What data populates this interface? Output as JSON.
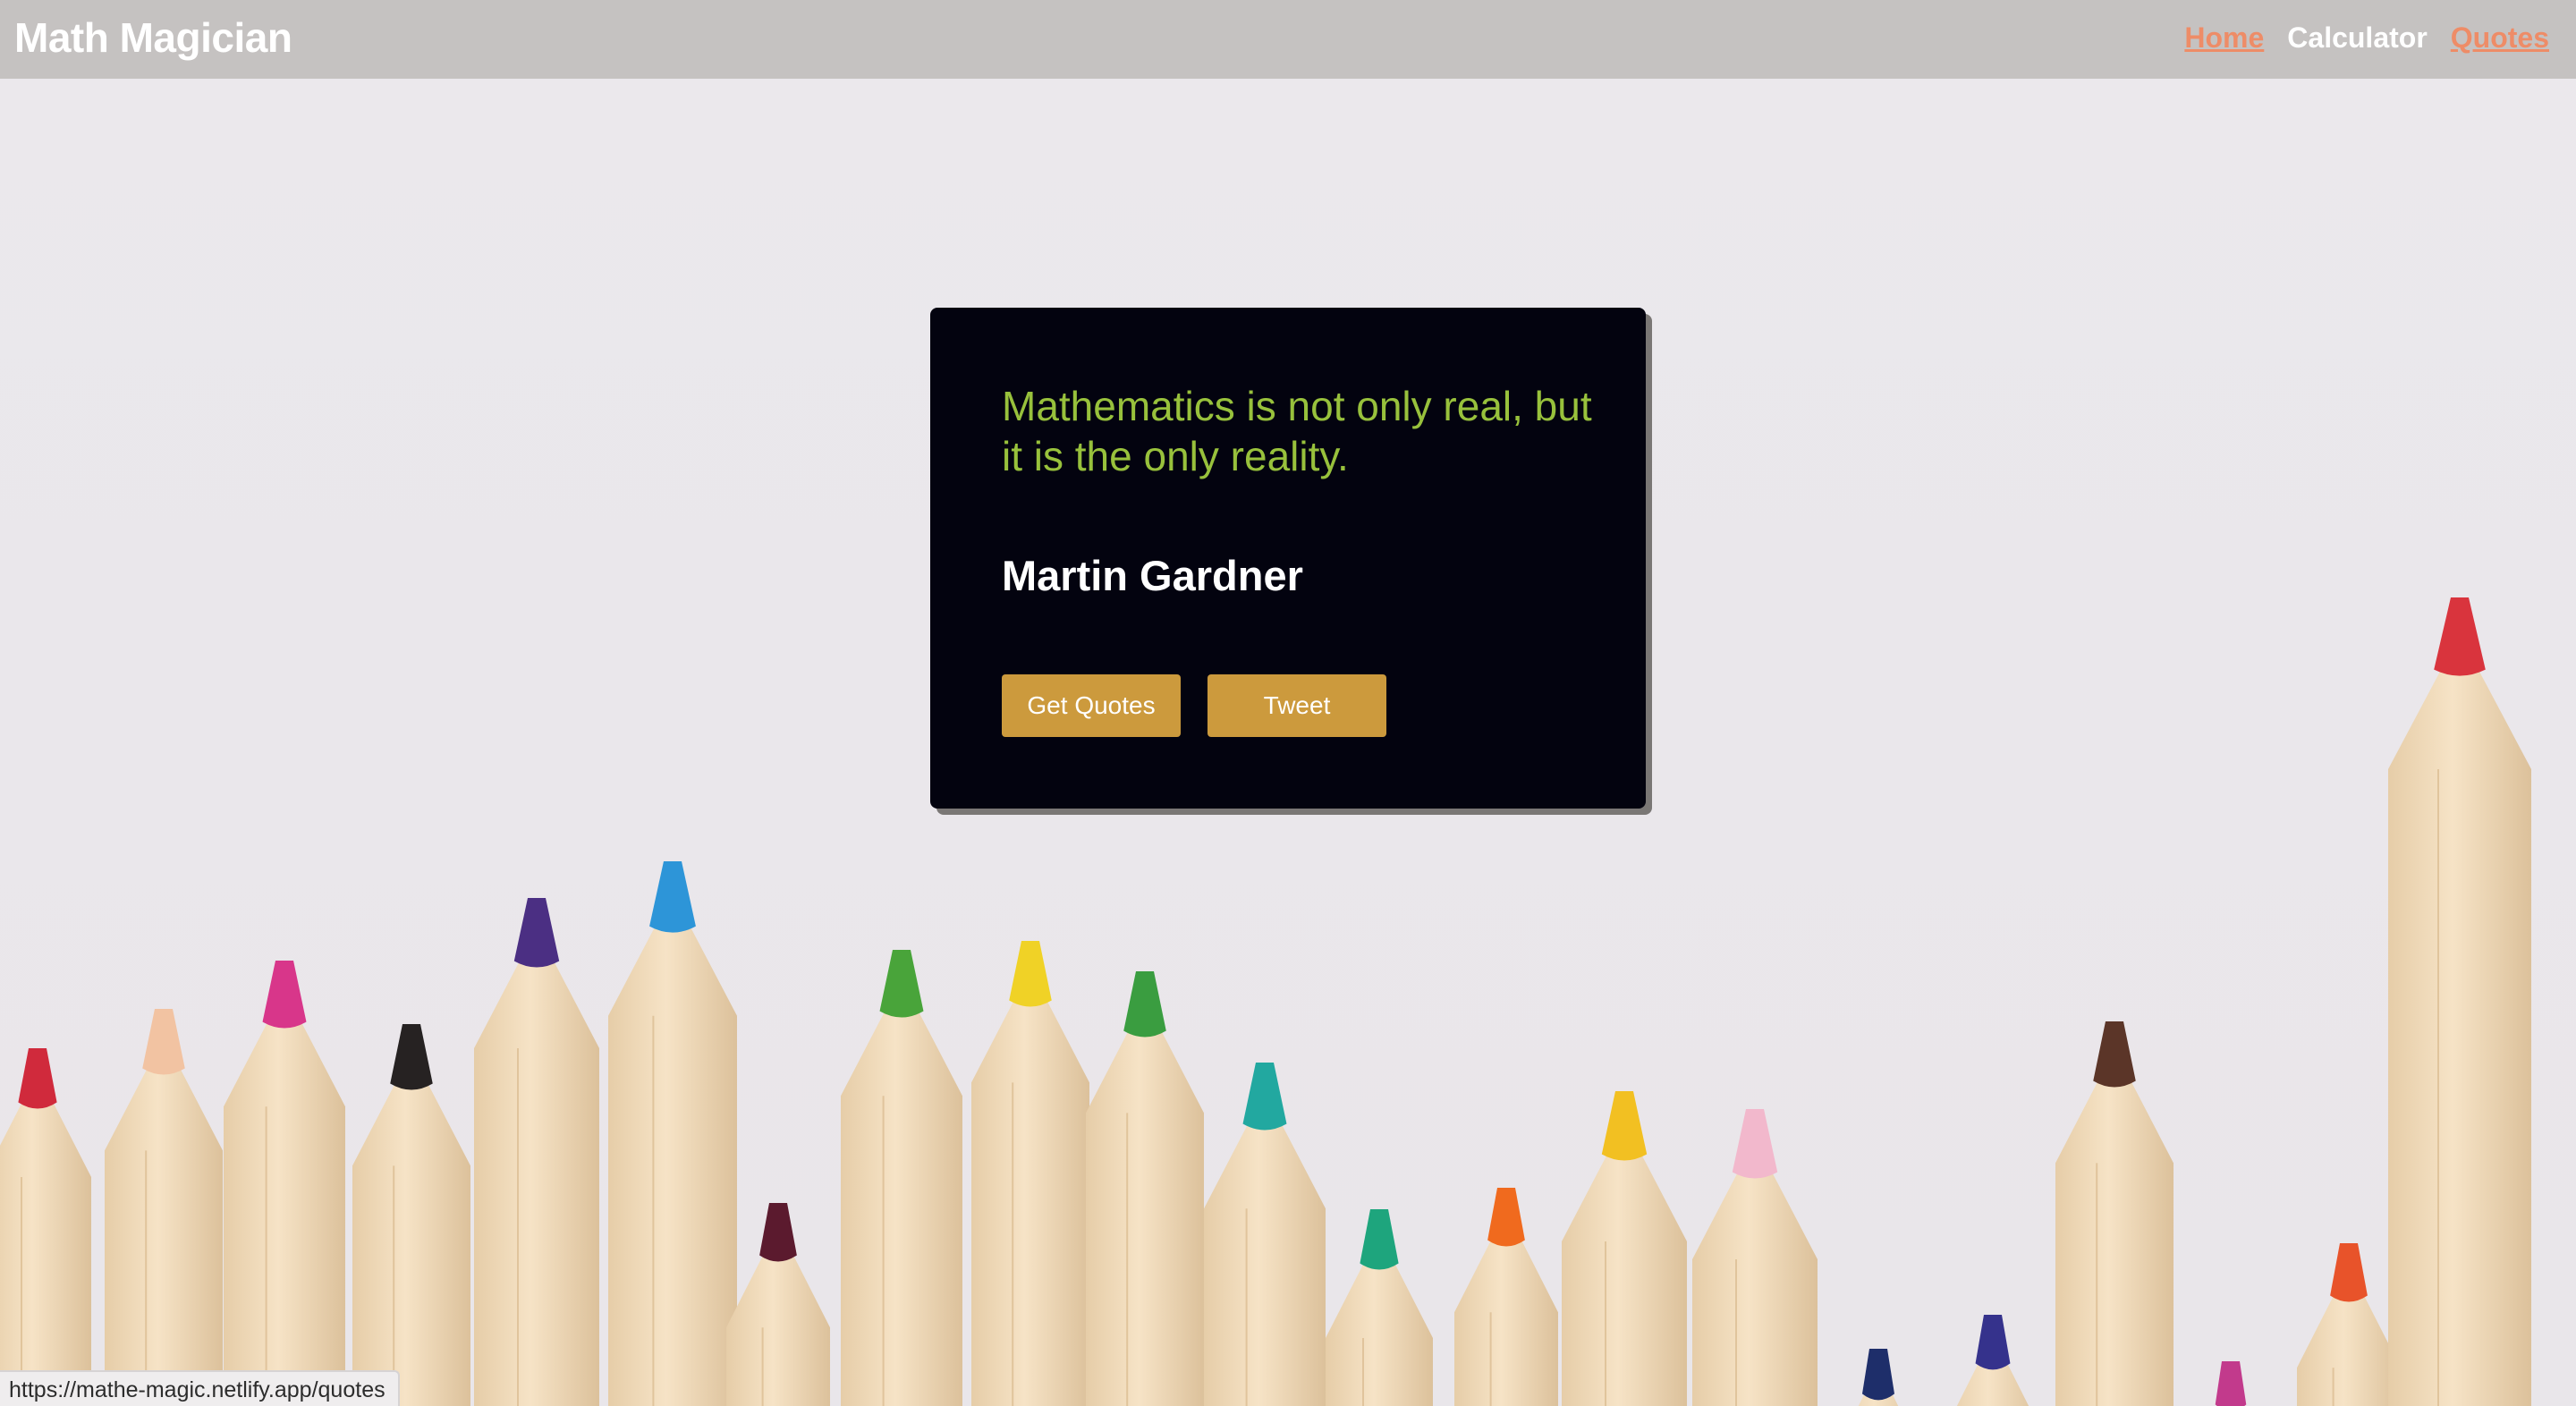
{
  "navbar": {
    "brand": "Math Magician",
    "links": [
      {
        "label": "Home"
      },
      {
        "label": "Calculator"
      },
      {
        "label": "Quotes"
      }
    ]
  },
  "quote_card": {
    "quote": "Mathematics is not only real, but it is the only reality.",
    "author": "Martin Gardner",
    "get_quotes_label": "Get Quotes",
    "tweet_label": "Tweet"
  },
  "status_bar": {
    "url": "https://mathe-magic.netlify.app/quotes"
  },
  "colors": {
    "navbar_bg": "#c5c2c1",
    "link_accent": "#ee8c67",
    "card_bg": "#03030f",
    "quote_text": "#98c13c",
    "button_bg": "#cc9a3d",
    "page_bg": "#ebe8ec"
  }
}
